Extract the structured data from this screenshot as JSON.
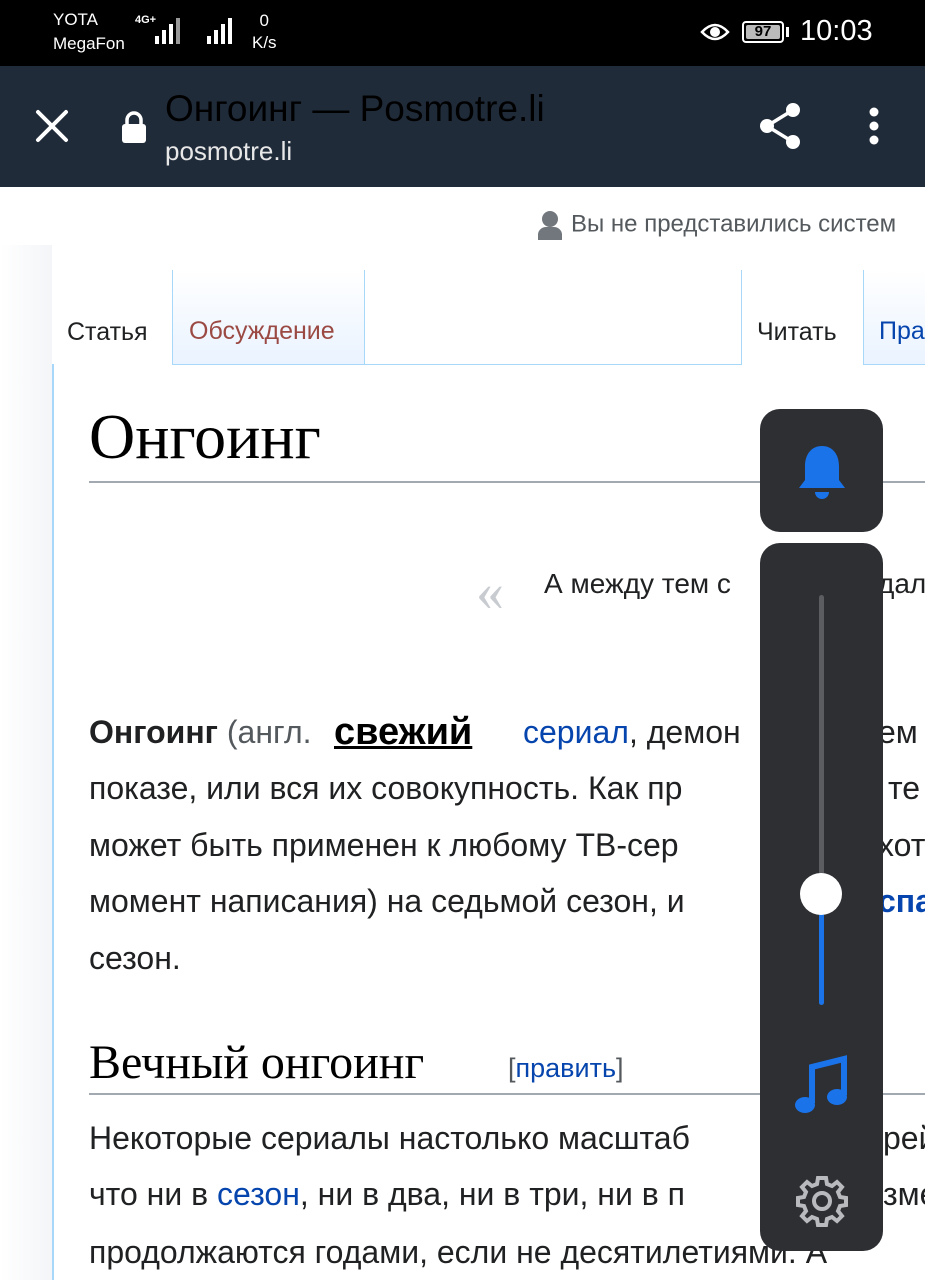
{
  "status_bar": {
    "carrier1": "YOTA",
    "carrier2": "MegaFon",
    "network_tag": "4G+",
    "speed_value": "0",
    "speed_unit": "K/s",
    "battery": "97",
    "time": "10:03"
  },
  "header": {
    "title": "Онгоинг — Posmotre.li",
    "url": "posmotre.li"
  },
  "page": {
    "user_notice": "Вы не представились систем",
    "tabs": {
      "article": "Статья",
      "talk": "Обсуждение",
      "read": "Читать",
      "edit": "Пра"
    },
    "heading": "Онгоинг",
    "quote_text": "А между тем с",
    "quote_tail": "дал",
    "popup_word": "свежий",
    "para1": {
      "bold": "Онгоинг",
      "paren": " (англ.",
      "link": "сериал",
      "rest1": ", демон",
      "tail1": "ем",
      "line2": "показе, или вся их совокупность. Как пр",
      "tail2": "те",
      "line3": "может быть применен к любому ТВ-сер",
      "tail3": "хот",
      "line4": "момент написания) на седьмой сезон, и",
      "tail4": "спа",
      "line5": "сезон."
    },
    "section_heading": "Вечный онгоинг",
    "edit_open": "[",
    "edit_link": "править",
    "edit_close": "]",
    "para2": {
      "line1": "Некоторые сериалы настолько масштаб",
      "tail1": "рей",
      "line2_pre": "что ни в ",
      "line2_link": "сезон",
      "line2_post": ", ни в два, ни в три, ни в п",
      "tail2": "зме",
      "line3": "продолжаются годами, если не десятилетиями. А"
    }
  },
  "volume_overlay": {
    "volume_level": 0.27,
    "accent_color": "#1a73e8",
    "icons": [
      "bell-icon",
      "music-note-icon",
      "gear-icon"
    ]
  }
}
